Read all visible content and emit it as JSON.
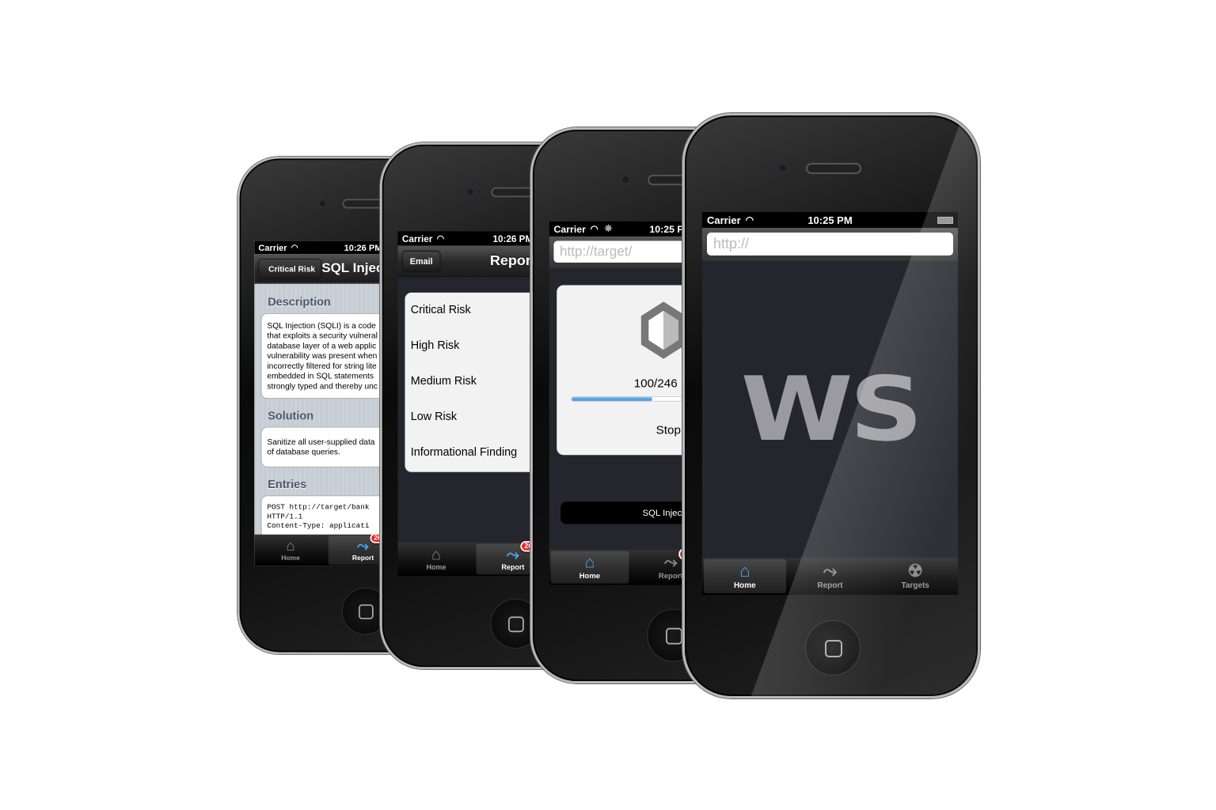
{
  "status": {
    "carrier": "Carrier",
    "time_1026": "10:26 PM",
    "time_1025": "10:25 PM"
  },
  "phone1": {
    "back": "Critical Risk",
    "title": "SQL Injection",
    "description_header": "Description",
    "description_lines": [
      "SQL Injection (SQLI) is a code",
      "that exploits a security vulneral",
      "database layer of a web applic",
      "vulnerability was present when",
      "incorrectly filtered for string lite",
      "embedded in SQL statements",
      "strongly typed and thereby unc"
    ],
    "solution_header": "Solution",
    "solution_lines": [
      "Sanitize all user-supplied data",
      "of database queries."
    ],
    "entries_header": "Entries",
    "entries_lines": [
      "POST http://target/bank",
      "HTTP/1.1",
      "Content-Type: applicati"
    ],
    "badge": "26"
  },
  "phone2": {
    "email": "Email",
    "title": "Report",
    "items": [
      "Critical Risk",
      "High Risk",
      "Medium Risk",
      "Low Risk",
      "Informational Finding"
    ],
    "badge": "26"
  },
  "phone3": {
    "url": "http://target/",
    "progress_text": "100/246",
    "progress": 0.4065,
    "stop": "Stop",
    "current_test": "SQL Injection"
  },
  "phone4": {
    "url_placeholder": "http://",
    "logo": "WS"
  },
  "tabs": {
    "home": "Home",
    "report": "Report",
    "targets": "Targets"
  },
  "icons": {
    "home": "house-icon",
    "report": "chart-icon",
    "targets": "radiation-icon",
    "wifi": "wifi-icon",
    "spinner": "activity-spinner-icon"
  },
  "colors": {
    "accent": "#4aa3e8",
    "badge": "#e22222",
    "screen_bg": "#25252d"
  }
}
